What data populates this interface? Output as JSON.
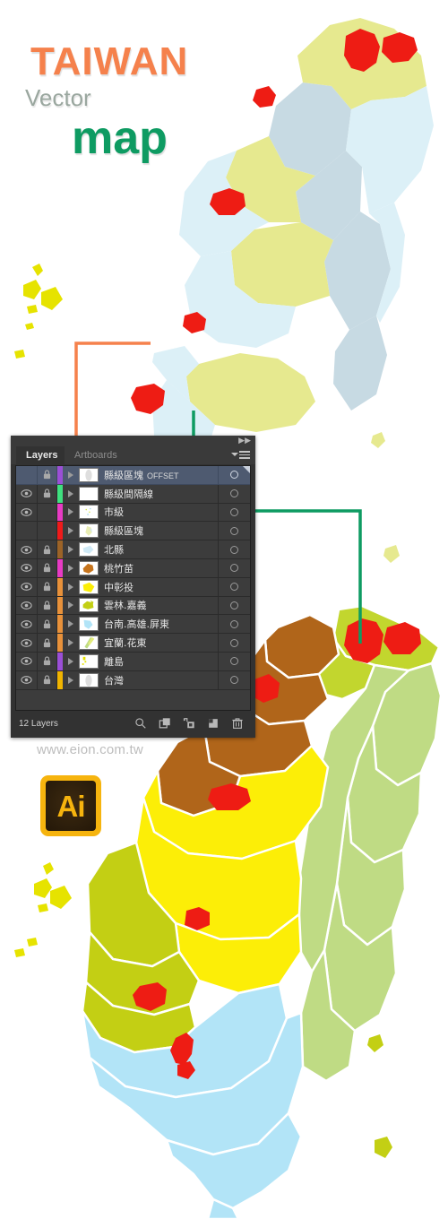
{
  "title_block": {
    "line1": "TAIWAN",
    "line2": "Vector",
    "line3": "map",
    "color1": "#F5814C",
    "color2": "#9AA79F",
    "color3": "#0E9B62"
  },
  "website": "www.eion.com.tw",
  "app_icon": {
    "name": "adobe-illustrator-icon",
    "glyph": "Ai",
    "frame_color": "#F6B40E",
    "body_color": "#2B1D0B"
  },
  "panel": {
    "tabs": [
      {
        "label": "Layers",
        "active": true
      },
      {
        "label": "Artboards",
        "active": false
      }
    ],
    "menu_icon": "panel-menu-icon",
    "collapse_icon": "collapse-icon",
    "footer": {
      "count_label": "12 Layers",
      "buttons": [
        {
          "name": "locate-object-button",
          "icon": "magnifier-icon"
        },
        {
          "name": "make-clipping-mask-button",
          "icon": "clipping-mask-icon"
        },
        {
          "name": "create-new-sublayer-button",
          "icon": "new-sublayer-icon"
        },
        {
          "name": "create-new-layer-button",
          "icon": "new-layer-icon"
        },
        {
          "name": "delete-selection-button",
          "icon": "trash-icon"
        }
      ]
    },
    "layers": [
      {
        "name": "縣級區塊",
        "suffix": "OFFSET",
        "visible": false,
        "locked": true,
        "selected": true,
        "strip": "#9B4FD6",
        "thumb": "grey-outline"
      },
      {
        "name": "縣級間隔線",
        "suffix": "",
        "visible": true,
        "locked": true,
        "selected": false,
        "strip": "#3FE07F",
        "thumb": "blank"
      },
      {
        "name": "市級",
        "suffix": "",
        "visible": true,
        "locked": false,
        "selected": false,
        "strip": "#E83BC4",
        "thumb": "dots"
      },
      {
        "name": "縣級區塊",
        "suffix": "",
        "visible": false,
        "locked": false,
        "selected": false,
        "strip": "#F01A1A",
        "thumb": "pale"
      },
      {
        "name": "北縣",
        "suffix": "",
        "visible": true,
        "locked": true,
        "selected": false,
        "strip": "#9C6327",
        "thumb": "lightblue"
      },
      {
        "name": "桃竹苗",
        "suffix": "",
        "visible": true,
        "locked": true,
        "selected": false,
        "strip": "#E83BC4",
        "thumb": "brown"
      },
      {
        "name": "中彰投",
        "suffix": "",
        "visible": true,
        "locked": true,
        "selected": false,
        "strip": "#E8913A",
        "thumb": "yellow"
      },
      {
        "name": "雲林.嘉義",
        "suffix": "",
        "visible": true,
        "locked": true,
        "selected": false,
        "strip": "#E8913A",
        "thumb": "olive"
      },
      {
        "name": "台南.高雄.屏東",
        "suffix": "",
        "visible": true,
        "locked": true,
        "selected": false,
        "strip": "#E8913A",
        "thumb": "skyblue"
      },
      {
        "name": "宜蘭.花東",
        "suffix": "",
        "visible": true,
        "locked": true,
        "selected": false,
        "strip": "#E8913A",
        "thumb": "green-strip"
      },
      {
        "name": "離島",
        "suffix": "",
        "visible": true,
        "locked": true,
        "selected": false,
        "strip": "#9B4FD6",
        "thumb": "islands"
      },
      {
        "name": "台灣",
        "suffix": "",
        "visible": true,
        "locked": true,
        "selected": false,
        "strip": "#F0B400",
        "thumb": "grey-outline"
      }
    ]
  },
  "callouts": [
    {
      "name": "orange-callout",
      "color": "#F5814C"
    },
    {
      "name": "green-callout",
      "color": "#0E9B62"
    },
    {
      "name": "green-callout-upper",
      "color": "#0E9B62"
    }
  ],
  "map": {
    "title": "Taiwan vector map",
    "palette": {
      "pale_yellow": "#E6E98F",
      "light_blue": "#DCF0F7",
      "grey_blue": "#C7DAE3",
      "olive_green": "#C2D62E",
      "sage_green": "#BFDB84",
      "brown": "#B0651A",
      "yellow": "#FCEE07",
      "dark_olive": "#C3CF14",
      "sky_blue": "#B2E4F7",
      "red": "#EE1C14",
      "island_yellow": "#E6E300",
      "border": "#FFFFFF"
    },
    "regions_top": [
      "北縣",
      "桃竹苗",
      "中彰投",
      "宜蘭.花東"
    ],
    "regions_bottom": [
      "桃竹苗",
      "中彰投",
      "雲林.嘉義",
      "台南.高雄.屏東",
      "宜蘭.花東"
    ],
    "cities_marked_color": "#EE1C14"
  }
}
